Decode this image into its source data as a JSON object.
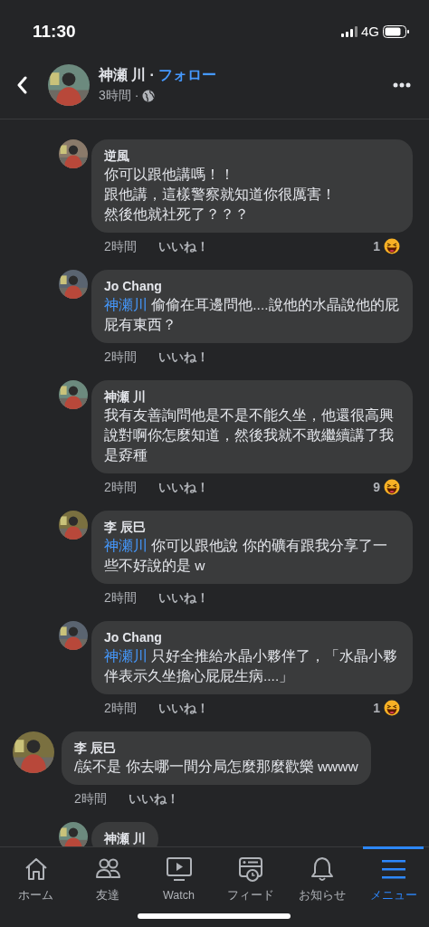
{
  "status_bar": {
    "time": "11:30",
    "network": "4G"
  },
  "header": {
    "author": "神瀬 川",
    "separator": "·",
    "follow": "フォロー",
    "time": "3時間",
    "time_separator": "·"
  },
  "comments": [
    {
      "kind": "reply",
      "author": "逆風",
      "lines": [
        "你可以跟他講嗎！！",
        "跟他講，這樣警察就知道你很厲害！",
        "然後他就社死了？？？"
      ],
      "time": "2時間",
      "like": "いいね！",
      "reaction_count": "1"
    },
    {
      "kind": "reply",
      "author": "Jo Chang",
      "mention": "神瀬川",
      "text": "偷偷在耳邊問他....說他的水晶說他的屁屁有東西？",
      "time": "2時間",
      "like": "いいね！"
    },
    {
      "kind": "reply",
      "author": "神瀬 川",
      "text": "我有友善詢問他是不是不能久坐，他還很高興說對啊你怎麼知道，然後我就不敢繼續講了我是孬種",
      "time": "2時間",
      "like": "いいね！",
      "reaction_count": "9"
    },
    {
      "kind": "reply",
      "author": "李 辰巳",
      "mention": "神瀬川",
      "text": "你可以跟他說 你的礦有跟我分享了一些不好說的是 w",
      "time": "2時間",
      "like": "いいね！"
    },
    {
      "kind": "reply",
      "author": "Jo Chang",
      "mention": "神瀬川",
      "text": "只好全推給水晶小夥伴了，「水晶小夥伴表示久坐擔心屁屁生病....」",
      "time": "2時間",
      "like": "いいね！",
      "reaction_count": "1"
    },
    {
      "kind": "top",
      "author": "李 辰巳",
      "text": "/誒不是 你去哪一間分局怎麼那麼歡樂 wwww",
      "time": "2時間",
      "like": "いいね！"
    },
    {
      "kind": "reply",
      "author": "神瀬 川"
    }
  ],
  "tabs": [
    {
      "kind": "home",
      "label": "ホーム",
      "selected": false
    },
    {
      "kind": "friends",
      "label": "友達",
      "selected": false
    },
    {
      "kind": "watch",
      "label": "Watch",
      "selected": false
    },
    {
      "kind": "feed",
      "label": "フィード",
      "selected": false
    },
    {
      "kind": "bell",
      "label": "お知らせ",
      "selected": false
    },
    {
      "kind": "menu",
      "label": "メニュー",
      "selected": true
    }
  ]
}
